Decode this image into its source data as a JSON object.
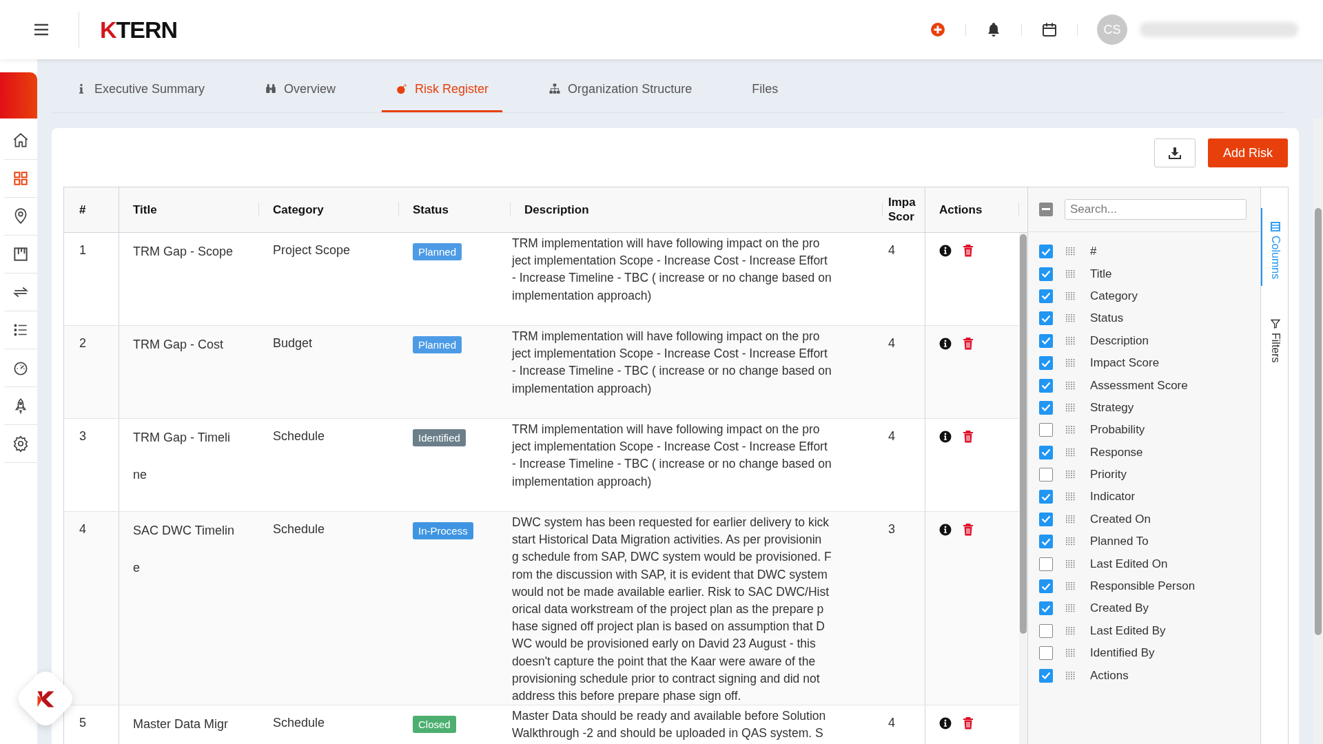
{
  "header": {
    "logo": {
      "mark": "K",
      "text": "TERN"
    },
    "avatar": "CS"
  },
  "sidebar": {
    "items": [
      {
        "selected": false
      },
      {
        "selected": true
      },
      {
        "selected": false
      },
      {
        "selected": false
      },
      {
        "selected": false
      },
      {
        "selected": false
      },
      {
        "selected": false
      },
      {
        "selected": false
      },
      {
        "selected": false
      }
    ]
  },
  "tabs": [
    {
      "label": "Executive Summary",
      "selected": false
    },
    {
      "label": "Overview",
      "selected": false
    },
    {
      "label": "Risk Register",
      "selected": true
    },
    {
      "label": "Organization Structure",
      "selected": false
    },
    {
      "label": "Files",
      "selected": false
    }
  ],
  "toolbar": {
    "add_button": "Add Risk"
  },
  "table": {
    "columns": [
      [
        "#"
      ],
      [
        "Title"
      ],
      [
        "Category"
      ],
      [
        "Status"
      ],
      [
        "Description"
      ],
      [
        "Impa",
        "Scor"
      ],
      [
        "Actions"
      ]
    ],
    "rows": [
      {
        "number": "1",
        "title": [
          "TRM Gap - Scope"
        ],
        "category": "Project Scope",
        "status": {
          "label": "Planned",
          "color": "#4d9be6"
        },
        "description": [
          "TRM implementation will have following impact on the pro",
          "ject implementation Scope - Increase Cost - Increase Effort",
          "- Increase Timeline - TBC ( increase or no change based on",
          "implementation approach)"
        ],
        "impact": "4"
      },
      {
        "number": "2",
        "title": [
          "TRM Gap - Cost"
        ],
        "category": "Budget",
        "status": {
          "label": "Planned",
          "color": "#4d9be6"
        },
        "description": [
          "TRM implementation will have following impact on the pro",
          "ject implementation Scope - Increase Cost - Increase Effort",
          "- Increase Timeline - TBC ( increase or no change based on",
          "implementation approach)"
        ],
        "impact": "4"
      },
      {
        "number": "3",
        "title": [
          "TRM Gap - Timeli",
          "ne"
        ],
        "category": "Schedule",
        "status": {
          "label": "Identified",
          "color": "#6b7f8a"
        },
        "description": [
          "TRM implementation will have following impact on the pro",
          "ject implementation Scope - Increase Cost - Increase Effort",
          "- Increase Timeline - TBC ( increase or no change based on",
          "implementation approach)"
        ],
        "impact": "4"
      },
      {
        "number": "4",
        "title": [
          "SAC DWC Timelin",
          "e"
        ],
        "category": "Schedule",
        "status": {
          "label": "In-Process",
          "color": "#3f95e2"
        },
        "description": [
          "DWC system has been requested for earlier delivery to kick",
          "start Historical Data Migration activities. As per provisionin",
          "g schedule from SAP, DWC system would be provisioned. F",
          "rom the discussion with SAP, it is evident that DWC system",
          "would not be made available earlier. Risk to SAC DWC/Hist",
          "orical data workstream of the project plan as the prepare p",
          "hase signed off project plan is based on assumption that D",
          "WC would be provisioned early on David 23 August - this",
          "doesn't capture the point that the Kaar were aware of the",
          "provisioning schedule prior to contract signing and did not",
          "address this before prepare phase sign off."
        ],
        "impact": "3"
      },
      {
        "number": "5",
        "title": [
          "Master Data Migr"
        ],
        "category": "Schedule",
        "status": {
          "label": "Closed",
          "color": "#4caf6f"
        },
        "description": [
          "Master Data should be ready and available before Solution",
          "Walkthrough -2 and should be uploaded in QAS system. S"
        ],
        "impact": "4"
      }
    ]
  },
  "column_chooser": {
    "select_all": {
      "indeterminate": true
    },
    "search": {
      "placeholder": "Search..."
    },
    "columns": [
      {
        "label": "#",
        "checked": true
      },
      {
        "label": "Title",
        "checked": true
      },
      {
        "label": "Category",
        "checked": true
      },
      {
        "label": "Status",
        "checked": true
      },
      {
        "label": "Description",
        "checked": true
      },
      {
        "label": "Impact Score",
        "checked": true
      },
      {
        "label": "Assessment Score",
        "checked": true
      },
      {
        "label": "Strategy",
        "checked": true
      },
      {
        "label": "Probability",
        "checked": false
      },
      {
        "label": "Response",
        "checked": true
      },
      {
        "label": "Priority",
        "checked": false
      },
      {
        "label": "Indicator",
        "checked": true
      },
      {
        "label": "Created On",
        "checked": true
      },
      {
        "label": "Planned To",
        "checked": true
      },
      {
        "label": "Last Edited On",
        "checked": false
      },
      {
        "label": "Responsible Person",
        "checked": true
      },
      {
        "label": "Created By",
        "checked": true
      },
      {
        "label": "Last Edited By",
        "checked": false
      },
      {
        "label": "Identified By",
        "checked": false
      },
      {
        "label": "Actions",
        "checked": true
      }
    ]
  },
  "side_tabs": [
    {
      "label": "Columns",
      "selected": true
    },
    {
      "label": "Filters",
      "selected": false
    }
  ]
}
